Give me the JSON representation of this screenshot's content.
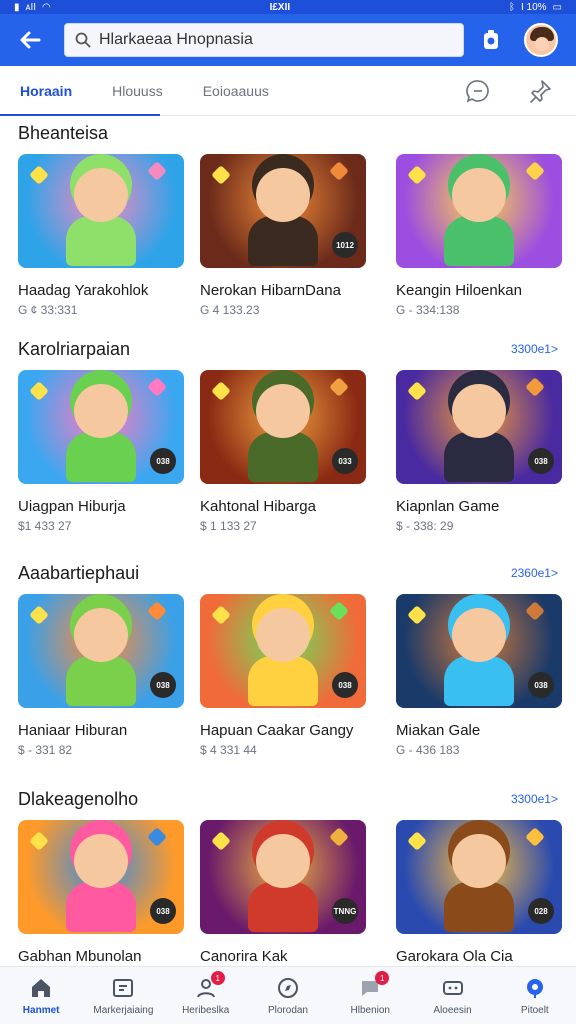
{
  "status_bar": {
    "left": "ᴀII",
    "center": "I£XII",
    "right": "I 10%"
  },
  "search": {
    "value": "Hlarkaeaa Hnopnasia",
    "placeholder": ""
  },
  "tabs": [
    {
      "label": "Horaain",
      "active": true
    },
    {
      "label": "Hlouuss",
      "active": false
    },
    {
      "label": "Eoioaauus",
      "active": false
    }
  ],
  "sections": [
    {
      "title": "Bheanteisa",
      "see_all": "",
      "cards": [
        {
          "title": "Haadag Yarakohlok",
          "sub": "G ¢ 33:331",
          "badge": "",
          "colors": [
            "#2fa3e8",
            "#f58ac0",
            "#8ee06a"
          ]
        },
        {
          "title": "Nerokan HibarnDana",
          "sub": "G 4 133.23",
          "badge": "1012",
          "colors": [
            "#6b2a1a",
            "#f08a3a",
            "#3a2a20"
          ]
        },
        {
          "title": "Keangin Hiloenkan",
          "sub": "G - 334:138",
          "badge": "",
          "colors": [
            "#9b4ee0",
            "#ffd24a",
            "#4ac06a"
          ]
        }
      ]
    },
    {
      "title": "Karolriarpaian",
      "see_all": "3300e1>",
      "cards": [
        {
          "title": "Uiagpan Hiburja",
          "sub": "$1 433 27",
          "badge": "038",
          "colors": [
            "#3aa7f0",
            "#ff7ac0",
            "#6ad050"
          ]
        },
        {
          "title": "Kahtonal Hibarga",
          "sub": "$ 1 133 27",
          "badge": "033",
          "colors": [
            "#8a2a14",
            "#f0a040",
            "#4a6a2a"
          ]
        },
        {
          "title": "Kiapnlan Game",
          "sub": "$ - 338: 29",
          "badge": "038",
          "colors": [
            "#4a2aa0",
            "#f09a3a",
            "#2a2a40"
          ]
        }
      ]
    },
    {
      "title": "Aaabartiephaui",
      "see_all": "2360e1>",
      "cards": [
        {
          "title": "Haniaar Hiburan",
          "sub": "$ - 331 82",
          "badge": "038",
          "colors": [
            "#3aa0e8",
            "#ff8a3a",
            "#7ad04a"
          ]
        },
        {
          "title": "Hapuan Caakar Gangy",
          "sub": "$ 4 331 44",
          "badge": "038",
          "colors": [
            "#f06a3a",
            "#6ae05a",
            "#ffd040"
          ]
        },
        {
          "title": "Miakan Gale",
          "sub": "G - 436 183",
          "badge": "038",
          "colors": [
            "#1a3a6a",
            "#d07a3a",
            "#3ac0f0"
          ]
        }
      ]
    },
    {
      "title": "Dlakeagenolho",
      "see_all": "3300e1>",
      "cards": [
        {
          "title": "Gabhan Mbunolan",
          "sub": "",
          "badge": "038",
          "colors": [
            "#ff9a2a",
            "#3a8ae0",
            "#ff5aa0"
          ]
        },
        {
          "title": "Canorira Kak",
          "sub": "",
          "badge": "TNNG",
          "colors": [
            "#6a1a6a",
            "#f0b040",
            "#d03a2a"
          ]
        },
        {
          "title": "Garokara Ola Cia",
          "sub": "",
          "badge": "028",
          "colors": [
            "#2a4ab0",
            "#ffc040",
            "#8a4a1a"
          ]
        }
      ]
    }
  ],
  "bottom_nav": [
    {
      "label": "Hanmet",
      "icon": "home-icon",
      "active": true,
      "dot": ""
    },
    {
      "label": "Markerjaiaing",
      "icon": "store-icon",
      "active": false,
      "dot": ""
    },
    {
      "label": "Heribeslka",
      "icon": "profile-icon",
      "active": false,
      "dot": "1"
    },
    {
      "label": "Plorodan",
      "icon": "compass-icon",
      "active": false,
      "dot": ""
    },
    {
      "label": "Hlbenion",
      "icon": "chat-icon",
      "active": false,
      "dot": "1"
    },
    {
      "label": "Aloeesin",
      "icon": "gamepad-icon",
      "active": false,
      "dot": ""
    },
    {
      "label": "Pitoelt",
      "icon": "pointer-icon",
      "active": false,
      "dot": ""
    }
  ]
}
